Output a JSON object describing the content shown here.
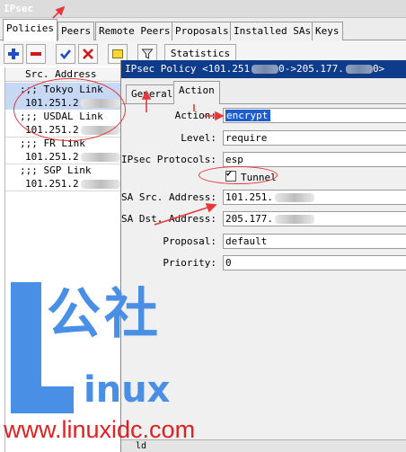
{
  "window": {
    "title": "IPsec"
  },
  "tabs": [
    "Policies",
    "Peers",
    "Remote Peers",
    "Proposals",
    "Installed SAs",
    "Keys"
  ],
  "toolbar": {
    "add_icon": "plus-icon",
    "remove_icon": "minus-icon",
    "enable_icon": "check-icon",
    "disable_icon": "x-icon",
    "comment_icon": "note-icon",
    "filter_icon": "filter-icon",
    "statistics_label": "Statistics"
  },
  "list": {
    "column_header": "Src. Address",
    "rows": [
      {
        "text": ";;; Tokyo Link",
        "kind": "comment"
      },
      {
        "text": "101.251.2",
        "kind": "entry"
      },
      {
        "text": ";;; USDAL Link",
        "kind": "comment"
      },
      {
        "text": "101.251.2",
        "kind": "entry"
      },
      {
        "text": ";;; FR Link",
        "kind": "comment"
      },
      {
        "text": "101.251.2",
        "kind": "entry"
      },
      {
        "text": ";;; SGP Link",
        "kind": "comment"
      },
      {
        "text": "101.251.2",
        "kind": "entry"
      }
    ]
  },
  "dialog": {
    "title_prefix": "IPsec Policy <101.251",
    "title_mid": "0->205.177.",
    "title_suffix": "0>",
    "tabs": [
      "General",
      "Action"
    ],
    "fields": {
      "action_label": "Action:",
      "action_value": "encrypt",
      "level_label": "Level:",
      "level_value": "require",
      "protocols_label": "IPsec Protocols:",
      "protocols_value": "esp",
      "tunnel_label": "Tunnel",
      "src_label": "SA Src. Address:",
      "src_value": "101.251.",
      "dst_label": "SA Dst. Address:",
      "dst_value": "205.177.",
      "proposal_label": "Proposal:",
      "proposal_value": "default",
      "priority_label": "Priority:",
      "priority_value": "0"
    },
    "bottom_text": "ld"
  },
  "watermark": {
    "cn_text": "公社",
    "inux_text": "inux",
    "url": "www.linuxidc.com"
  },
  "colors": {
    "dialog_title_bg": "#0e3b8a",
    "selection": "#c6d8f4",
    "highlight_field": "#1c5ed1",
    "annotation_red": "#e8373a",
    "watermark_blue": "#4a8fe6",
    "url_red": "#e01f1f"
  }
}
